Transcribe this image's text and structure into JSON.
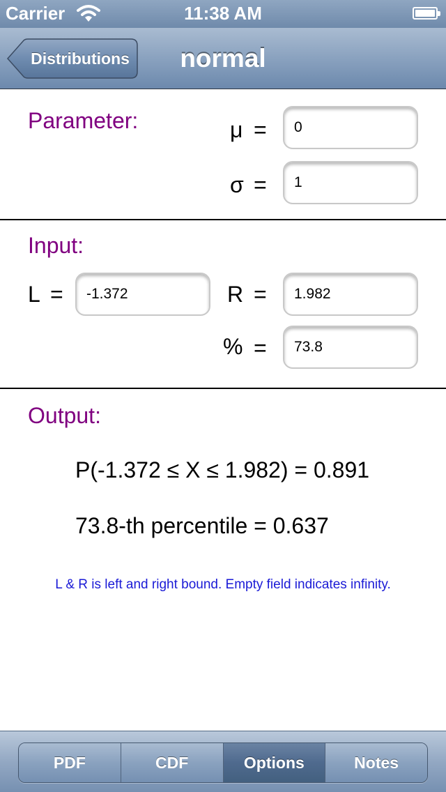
{
  "status_bar": {
    "carrier": "Carrier",
    "time": "11:38 AM",
    "icons": [
      "wifi-icon",
      "battery-icon"
    ]
  },
  "nav": {
    "back_label": "Distributions",
    "title": "normal"
  },
  "parameter": {
    "heading": "Parameter:",
    "mu_symbol": "μ",
    "sigma_symbol": "σ",
    "equals": "=",
    "mu_value": "0",
    "sigma_value": "1"
  },
  "input": {
    "heading": "Input:",
    "l_symbol": "L",
    "r_symbol": "R",
    "pct_symbol": "%",
    "equals": "=",
    "l_value": "-1.372",
    "r_value": "1.982",
    "pct_value": "73.8"
  },
  "output": {
    "heading": "Output:",
    "probability": "P(-1.372 ≤ X ≤ 1.982) = 0.891",
    "percentile": "73.8-th percentile = 0.637",
    "note": "L & R is left and right bound. Empty field indicates infinity."
  },
  "tabs": {
    "items": [
      "PDF",
      "CDF",
      "Options",
      "Notes"
    ],
    "selected": "Options"
  },
  "colors": {
    "heading": "#800080",
    "note": "#1a1ad6",
    "bar": "#8aa2bf",
    "selected_tab": "#4f6a8e"
  }
}
